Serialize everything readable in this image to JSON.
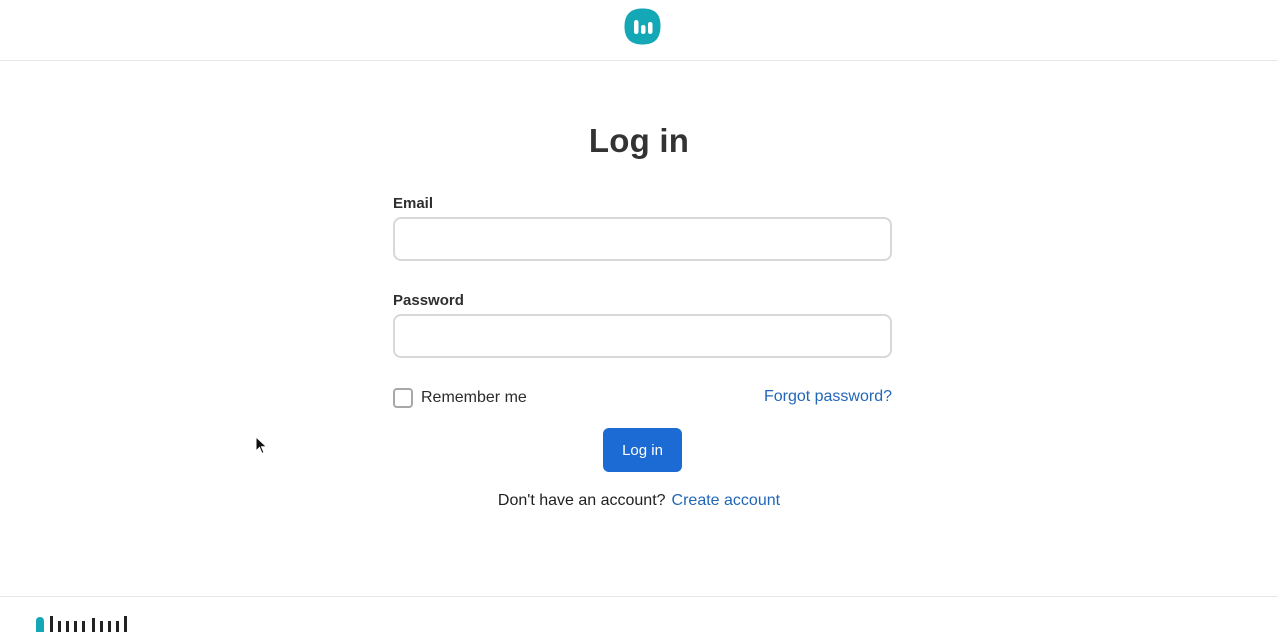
{
  "header": {
    "logo_icon": "brand-logo-icon",
    "brand_color": "#14a7b5"
  },
  "form": {
    "title": "Log in",
    "email_label": "Email",
    "email_value": "",
    "password_label": "Password",
    "password_value": "",
    "remember_label": "Remember me",
    "remember_checked": false,
    "forgot_label": "Forgot password?",
    "submit_label": "Log in",
    "signup_prompt": "Don't have an account?",
    "signup_link": "Create account"
  },
  "footer": {
    "logo_icon": "footer-brand-logo-icon"
  },
  "colors": {
    "primary": "#1c6ad3",
    "link": "#2266b8",
    "brand": "#14a7b5"
  }
}
